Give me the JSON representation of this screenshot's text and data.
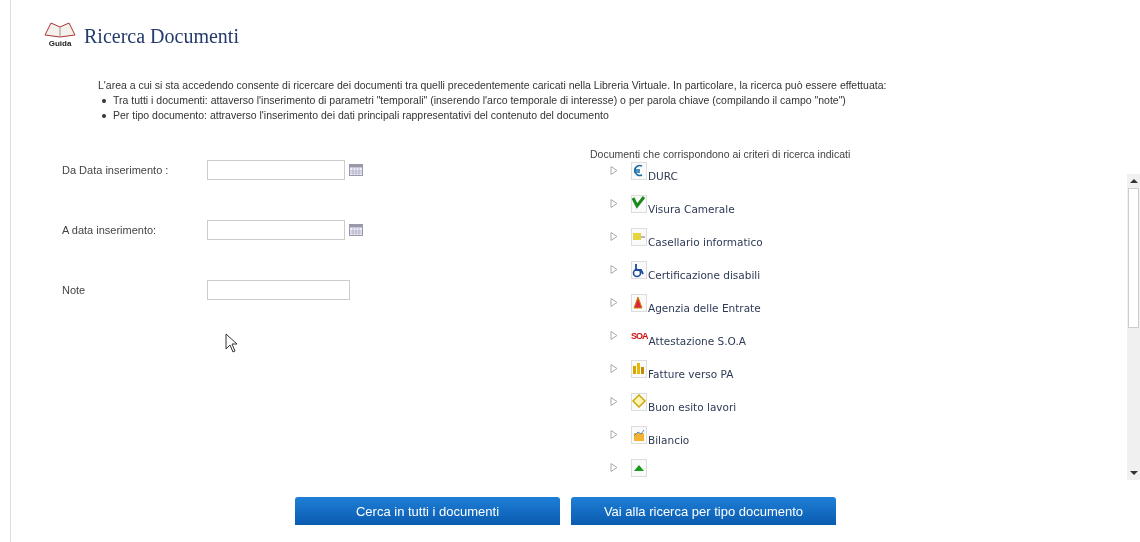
{
  "header": {
    "icon_label": "Guida",
    "title": "Ricerca Documenti"
  },
  "intro": {
    "text": "L'area a cui si sta accedendo consente di ricercare dei documenti tra quelli precedentemente caricati nella Libreria Virtuale. In particolare, la ricerca può essere effettuata:",
    "bullets": [
      "Tra tutti i documenti: attaverso l'inserimento di parametri \"temporali\" (inserendo l'arco temporale di interesse) o per parola chiave (compilando il campo \"note\")",
      "Per tipo documento: attraverso l'inserimento dei dati principali rappresentativi del contenuto del documento"
    ]
  },
  "form": [
    {
      "label": "Da Data inserimento :",
      "kind": "date"
    },
    {
      "label": "A data inserimento:",
      "kind": "date"
    },
    {
      "label": "Note",
      "kind": "text"
    }
  ],
  "results": {
    "title": "Documenti che corrispondono ai criteri di ricerca indicati",
    "items": [
      {
        "label": "DURC",
        "kind": "euro",
        "expanded": false
      },
      {
        "label": "Visura Camerale",
        "kind": "check",
        "expanded": false
      },
      {
        "label": "Casellario informatico",
        "kind": "folder",
        "expanded": false
      },
      {
        "label": "Certificazione disabili",
        "kind": "wheelchair",
        "expanded": false
      },
      {
        "label": "Agenzia delle Entrate",
        "kind": "agency",
        "expanded": false
      },
      {
        "label": "Attestazione S.O.A",
        "kind": "soa",
        "icon_text": "SOA",
        "expanded": false
      },
      {
        "label": "Fatture verso PA",
        "kind": "bars",
        "expanded": false
      },
      {
        "label": "Buon esito lavori",
        "kind": "diamond",
        "expanded": false
      },
      {
        "label": "Bilancio",
        "kind": "chart",
        "expanded": false
      },
      {
        "kind": "triangle",
        "expanded": false
      }
    ]
  },
  "buttons": [
    "Cerca in tutti i documenti",
    "Vai alla ricerca per tipo documento"
  ]
}
